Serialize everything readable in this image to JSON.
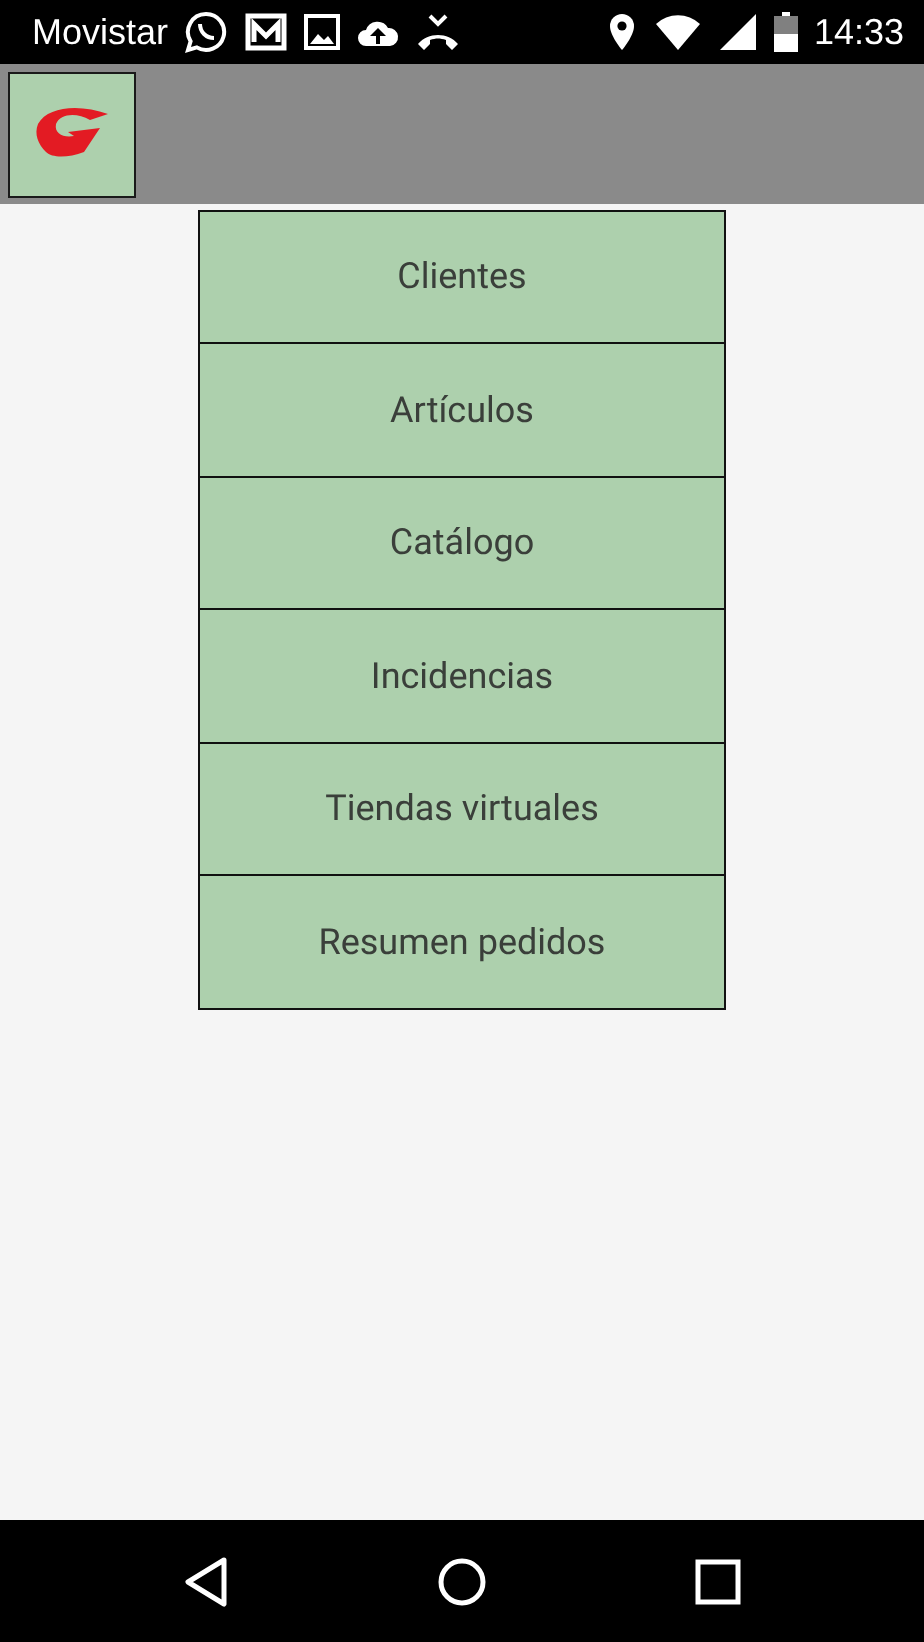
{
  "status_bar": {
    "carrier": "Movistar",
    "time": "14:33"
  },
  "menu": [
    {
      "label": "Clientes"
    },
    {
      "label": "Artículos"
    },
    {
      "label": "Catálogo"
    },
    {
      "label": "Incidencias"
    },
    {
      "label": "Tiendas virtuales"
    },
    {
      "label": "Resumen pedidos"
    }
  ]
}
